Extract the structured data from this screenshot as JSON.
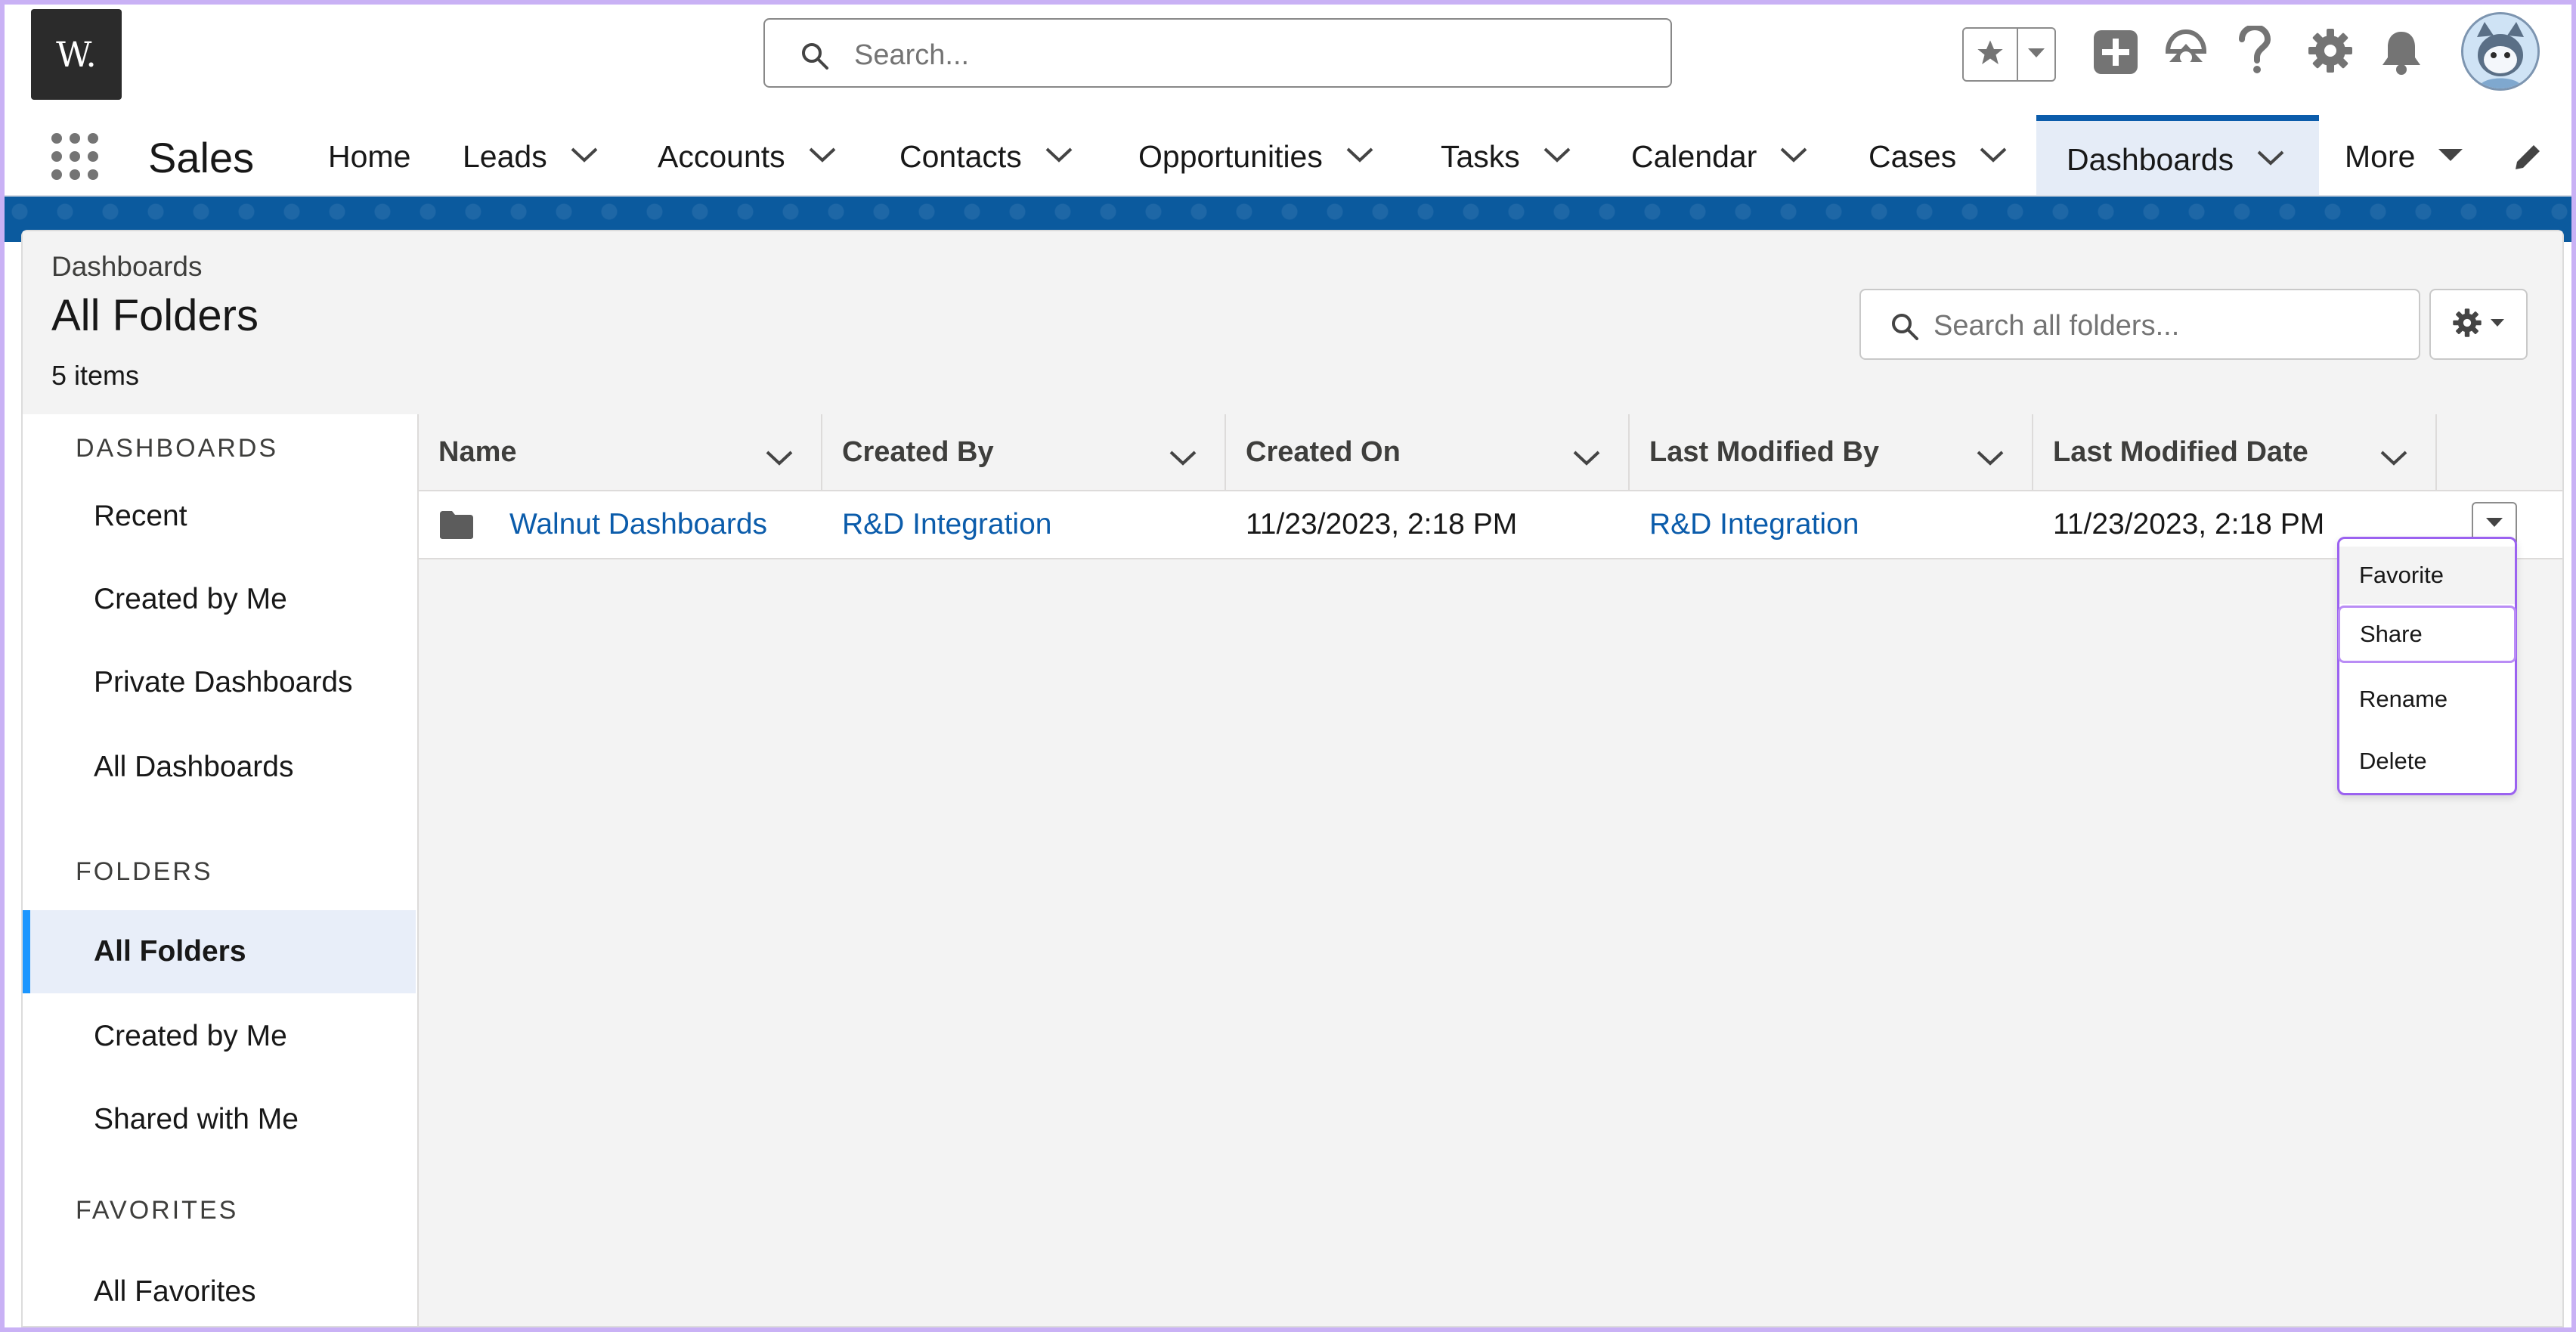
{
  "colors": {
    "brand_blue": "#0b5cab",
    "link_blue": "#0b5cab",
    "active_tab_bg": "#e5ecf7",
    "active_sidebar_bar": "#1b96ff",
    "menu_border": "#9b62f0",
    "banner_blue": "#0b5a9e"
  },
  "header": {
    "logo_text": "W.",
    "search_placeholder": "Search...",
    "icons": [
      "star-icon",
      "chevron-down-icon",
      "add-icon",
      "trailhead-icon",
      "help-icon",
      "setup-gear-icon",
      "notification-bell-icon",
      "avatar"
    ]
  },
  "nav": {
    "app_name": "Sales",
    "items": [
      {
        "label": "Home"
      },
      {
        "label": "Leads"
      },
      {
        "label": "Accounts"
      },
      {
        "label": "Contacts"
      },
      {
        "label": "Opportunities"
      },
      {
        "label": "Tasks"
      },
      {
        "label": "Calendar"
      },
      {
        "label": "Cases"
      },
      {
        "label": "Dashboards"
      },
      {
        "label": "More"
      }
    ]
  },
  "page": {
    "breadcrumb": "Dashboards",
    "title": "All Folders",
    "item_count": "5 items",
    "search_placeholder": "Search all folders..."
  },
  "sidebar": {
    "sections": [
      {
        "heading": "DASHBOARDS",
        "items": [
          "Recent",
          "Created by Me",
          "Private Dashboards",
          "All Dashboards"
        ]
      },
      {
        "heading": "FOLDERS",
        "items": [
          "All Folders",
          "Created by Me",
          "Shared with Me"
        ]
      },
      {
        "heading": "FAVORITES",
        "items": [
          "All Favorites"
        ]
      }
    ],
    "active_item": "All Folders"
  },
  "table": {
    "columns": [
      "Name",
      "Created By",
      "Created On",
      "Last Modified By",
      "Last Modified Date"
    ],
    "rows": [
      {
        "name": "Walnut Dashboards",
        "created_by": "R&D Integration",
        "created_on": "11/23/2023, 2:18 PM",
        "last_modified_by": "R&D Integration",
        "last_modified_date": "11/23/2023, 2:18 PM"
      }
    ]
  },
  "row_menu": {
    "items": [
      "Favorite",
      "Share",
      "Rename",
      "Delete"
    ],
    "highlighted": "Share"
  }
}
